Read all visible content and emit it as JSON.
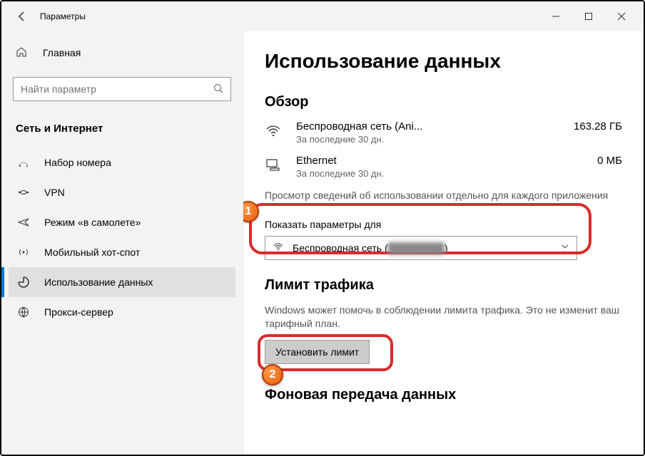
{
  "window": {
    "title": "Параметры"
  },
  "sidebar": {
    "home": "Главная",
    "search_placeholder": "Найти параметр",
    "section": "Сеть и Интернет",
    "items": [
      {
        "label": "Набор номера",
        "icon": "dialup"
      },
      {
        "label": "VPN",
        "icon": "vpn"
      },
      {
        "label": "Режим «в самолете»",
        "icon": "airplane"
      },
      {
        "label": "Мобильный хот-спот",
        "icon": "hotspot"
      },
      {
        "label": "Использование данных",
        "icon": "data",
        "active": true
      },
      {
        "label": "Прокси-сервер",
        "icon": "proxy"
      }
    ]
  },
  "main": {
    "page_title": "Использование данных",
    "overview": {
      "heading": "Обзор",
      "rows": [
        {
          "name": "Беспроводная сеть (Ani...",
          "sub": "За последние 30 дн.",
          "value": "163.28 ГБ",
          "icon": "wifi"
        },
        {
          "name": "Ethernet",
          "sub": "За последние 30 дн.",
          "value": "0 МБ",
          "icon": "ethernet"
        }
      ],
      "view_per_app": "Просмотр сведений об использовании отдельно для каждого приложения"
    },
    "show_for": {
      "label": "Показать параметры для",
      "selected_prefix": "Беспроводная сеть (",
      "selected_hidden": "████████",
      "selected_suffix": ")"
    },
    "limit": {
      "heading": "Лимит трафика",
      "desc": "Windows может помочь в соблюдении лимита трафика. Это не изменит ваш тарифный план.",
      "button": "Установить лимит"
    },
    "background": {
      "heading": "Фоновая передача данных"
    }
  },
  "annotations": {
    "badge1": "1",
    "badge2": "2"
  }
}
